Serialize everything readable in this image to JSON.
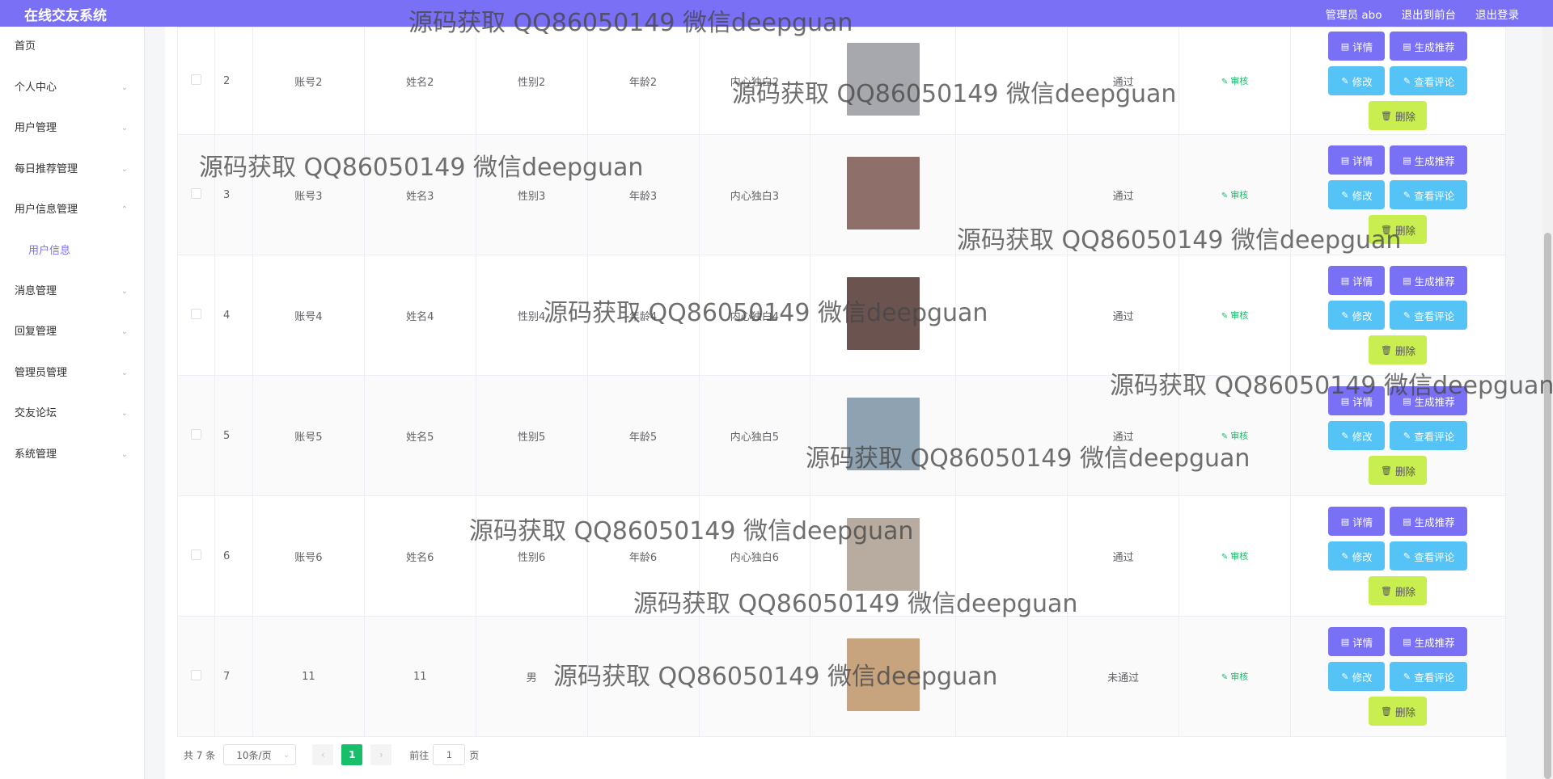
{
  "header": {
    "app_title": "在线交友系统",
    "user_label": "管理员 abo",
    "front_link": "退出到前台",
    "logout_link": "退出登录"
  },
  "sidebar": {
    "items": [
      {
        "label": "首页"
      },
      {
        "label": "个人中心"
      },
      {
        "label": "用户管理"
      },
      {
        "label": "每日推荐管理"
      },
      {
        "label": "用户信息管理"
      },
      {
        "label": "消息管理"
      },
      {
        "label": "回复管理"
      },
      {
        "label": "管理员管理"
      },
      {
        "label": "交友论坛"
      },
      {
        "label": "系统管理"
      }
    ],
    "submenu_active": "用户信息"
  },
  "table": {
    "rows": [
      {
        "index": "2",
        "account": "账号2",
        "name": "姓名2",
        "gender": "性别2",
        "age": "年龄2",
        "monologue": "内心独白2",
        "status": "通过",
        "photo_color": "#a7a8ad"
      },
      {
        "index": "3",
        "account": "账号3",
        "name": "姓名3",
        "gender": "性别3",
        "age": "年龄3",
        "monologue": "内心独白3",
        "status": "通过",
        "photo_color": "#8e6f6a"
      },
      {
        "index": "4",
        "account": "账号4",
        "name": "姓名4",
        "gender": "性别4",
        "age": "年龄4",
        "monologue": "内心独白4",
        "status": "通过",
        "photo_color": "#6b5450"
      },
      {
        "index": "5",
        "account": "账号5",
        "name": "姓名5",
        "gender": "性别5",
        "age": "年龄5",
        "monologue": "内心独白5",
        "status": "通过",
        "photo_color": "#8ea2b1"
      },
      {
        "index": "6",
        "account": "账号6",
        "name": "姓名6",
        "gender": "性别6",
        "age": "年龄6",
        "monologue": "内心独白6",
        "status": "通过",
        "photo_color": "#b8aca0"
      },
      {
        "index": "7",
        "account": "11",
        "name": "11",
        "gender": "男",
        "age": "",
        "monologue": "",
        "status": "未通过",
        "photo_color": "#c7a47e"
      }
    ],
    "audit_label": "审核",
    "buttons": {
      "detail": "详情",
      "generate": "生成推荐",
      "edit": "修改",
      "comments": "查看评论",
      "delete": "删除"
    }
  },
  "pagination": {
    "total": "共 7 条",
    "page_size": "10条/页",
    "current_page": "1",
    "goto_prefix": "前往",
    "goto_value": "1",
    "goto_suffix": "页"
  },
  "watermark": "源码获取 QQ86050149 微信deepguan",
  "colors": {
    "primary": "#7a70f5",
    "info": "#55c3f5",
    "success": "#19be6b",
    "delete": "#c9ee4f"
  }
}
